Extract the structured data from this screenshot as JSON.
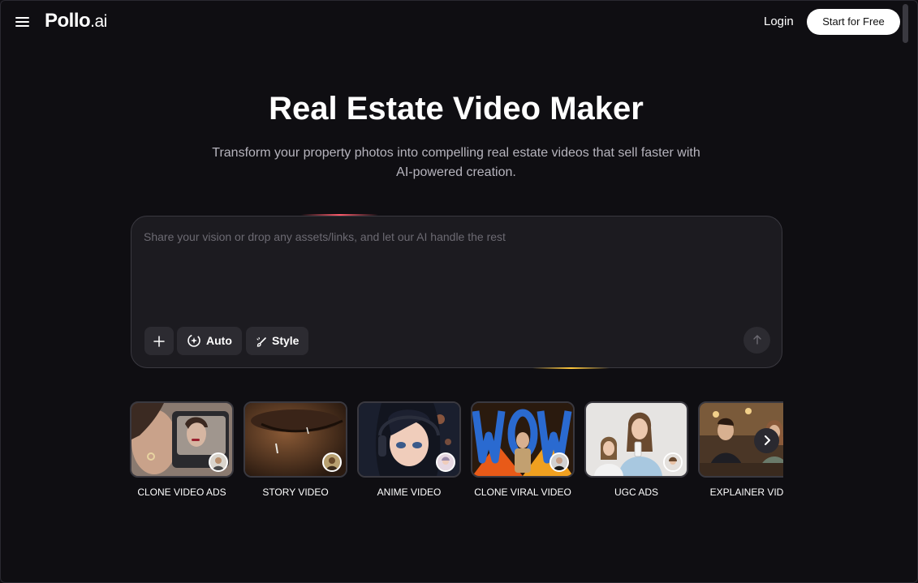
{
  "header": {
    "logo_main": "Pollo",
    "logo_suffix": ".ai",
    "login_label": "Login",
    "start_label": "Start for Free"
  },
  "hero": {
    "title": "Real Estate Video Maker",
    "subtitle": "Transform your property photos into compelling real estate videos that sell faster with AI-powered creation."
  },
  "prompt": {
    "placeholder": "Share your vision or drop any assets/links, and let our AI handle the rest",
    "auto_label": "Auto",
    "style_label": "Style"
  },
  "templates": [
    {
      "label": "CLONE VIDEO ADS"
    },
    {
      "label": "STORY VIDEO"
    },
    {
      "label": "ANIME VIDEO"
    },
    {
      "label": "CLONE VIRAL VIDEO"
    },
    {
      "label": "UGC ADS"
    },
    {
      "label": "EXPLAINER VIDE"
    }
  ],
  "icons": {
    "menu": "hamburger-menu-icon",
    "add": "plus-icon",
    "auto": "auto-spin-icon",
    "style": "brush-icon",
    "send": "arrow-up-icon",
    "next": "chevron-right-icon"
  },
  "colors": {
    "background": "#0f0e12",
    "panel": "#1c1b20",
    "button": "#2c2b31",
    "primary_text": "#ffffff",
    "muted_text": "#b6b4bd"
  }
}
